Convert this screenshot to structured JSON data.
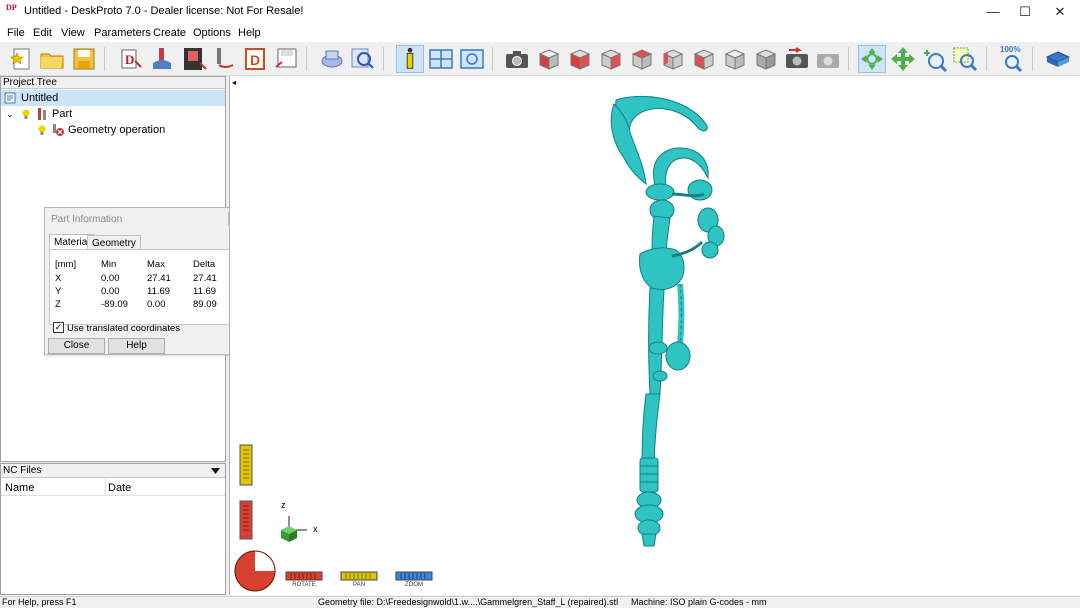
{
  "window": {
    "title": "Untitled - DeskProto 7.0 - Dealer license: Not For Resale!",
    "logo_text": "DP",
    "controls": {
      "minimize": "—",
      "maximize": "☐",
      "close": "✕"
    }
  },
  "menu": [
    "File",
    "Edit",
    "View",
    "Parameters",
    "Create",
    "Options",
    "Help"
  ],
  "toolbar": {
    "zoom_label": "100%"
  },
  "project_tree": {
    "header": "Project Tree",
    "items": [
      {
        "label": "Untitled",
        "level": 0
      },
      {
        "label": "Part",
        "level": 1
      },
      {
        "label": "Geometry operation",
        "level": 2
      }
    ]
  },
  "nc_files": {
    "header": "NC Files",
    "columns": [
      "Name",
      "Date"
    ]
  },
  "part_info": {
    "title": "Part Information",
    "tabs": [
      "Material",
      "Geometry"
    ],
    "active_tab": "Material",
    "columns": [
      "[mm]",
      "Min",
      "Max",
      "Delta"
    ],
    "rows": [
      [
        "X",
        "0.00",
        "27.41",
        "27.41"
      ],
      [
        "Y",
        "0.00",
        "11.69",
        "11.69"
      ],
      [
        "Z",
        "-89.09",
        "0.00",
        "89.09"
      ]
    ],
    "checkbox_label": "Use translated coordinates",
    "checkbox_checked": true,
    "close_label": "Close",
    "help_label": "Help"
  },
  "viewport": {
    "axis_z": "z",
    "axis_x": "x",
    "controls": [
      "ROTATE",
      "PAN",
      "ZOOM"
    ],
    "model_color": "#2ec4c4"
  },
  "status": {
    "help": "For Help, press F1",
    "geometry_file": "Geometry file: D:\\Freedesignwold\\1.w....\\Gammelgren_Staff_L (repaired).stl",
    "machine": "Machine: ISO plain G-codes - mm"
  }
}
